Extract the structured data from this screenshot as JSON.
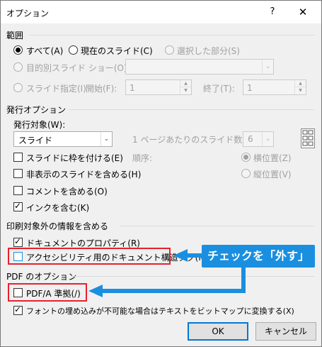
{
  "window": {
    "title": "オプション",
    "help": "?",
    "close": "✕"
  },
  "range": {
    "section": "範囲",
    "all": "すべて(A)",
    "current": "現在のスライド(C)",
    "selection": "選択した部分(S)",
    "custom_show": "目的別スライド ショー(O):",
    "slides": "スライド指定(I)",
    "start_label": "開始(F):",
    "start_value": "1",
    "end_label": "終了(T):",
    "end_value": "1"
  },
  "publish": {
    "section": "発行オプション",
    "target_label": "発行対象(W):",
    "target_value": "スライド",
    "per_page_label": "1 ページあたりのスライド数(L):",
    "per_page_value": "6",
    "order_label": "順序:",
    "horizontal": "横位置(Z)",
    "vertical": "縦位置(V)",
    "frame": "スライドに枠を付ける(E)",
    "hidden": "非表示のスライドを含める(H)",
    "comments": "コメントを含める(O)",
    "ink": "インクを含む(K)"
  },
  "nonprint": {
    "section": "印刷対象外の情報を含める",
    "doc_props": "ドキュメントのプロパティ(R)",
    "accessibility": "アクセシビリティ用のドキュメント構造タグ(M)"
  },
  "pdf": {
    "section": "PDF のオプション",
    "pdfa": "PDF/A 準拠(/)",
    "bitmap": "フォントの埋め込みが不可能な場合はテキストをビットマップに変換する(X)"
  },
  "buttons": {
    "ok": "OK",
    "cancel": "キャンセル"
  },
  "annotation": {
    "text": "チェックを「外す」"
  },
  "colors": {
    "accent": "#1a8fe0",
    "highlight": "#e8212c"
  }
}
